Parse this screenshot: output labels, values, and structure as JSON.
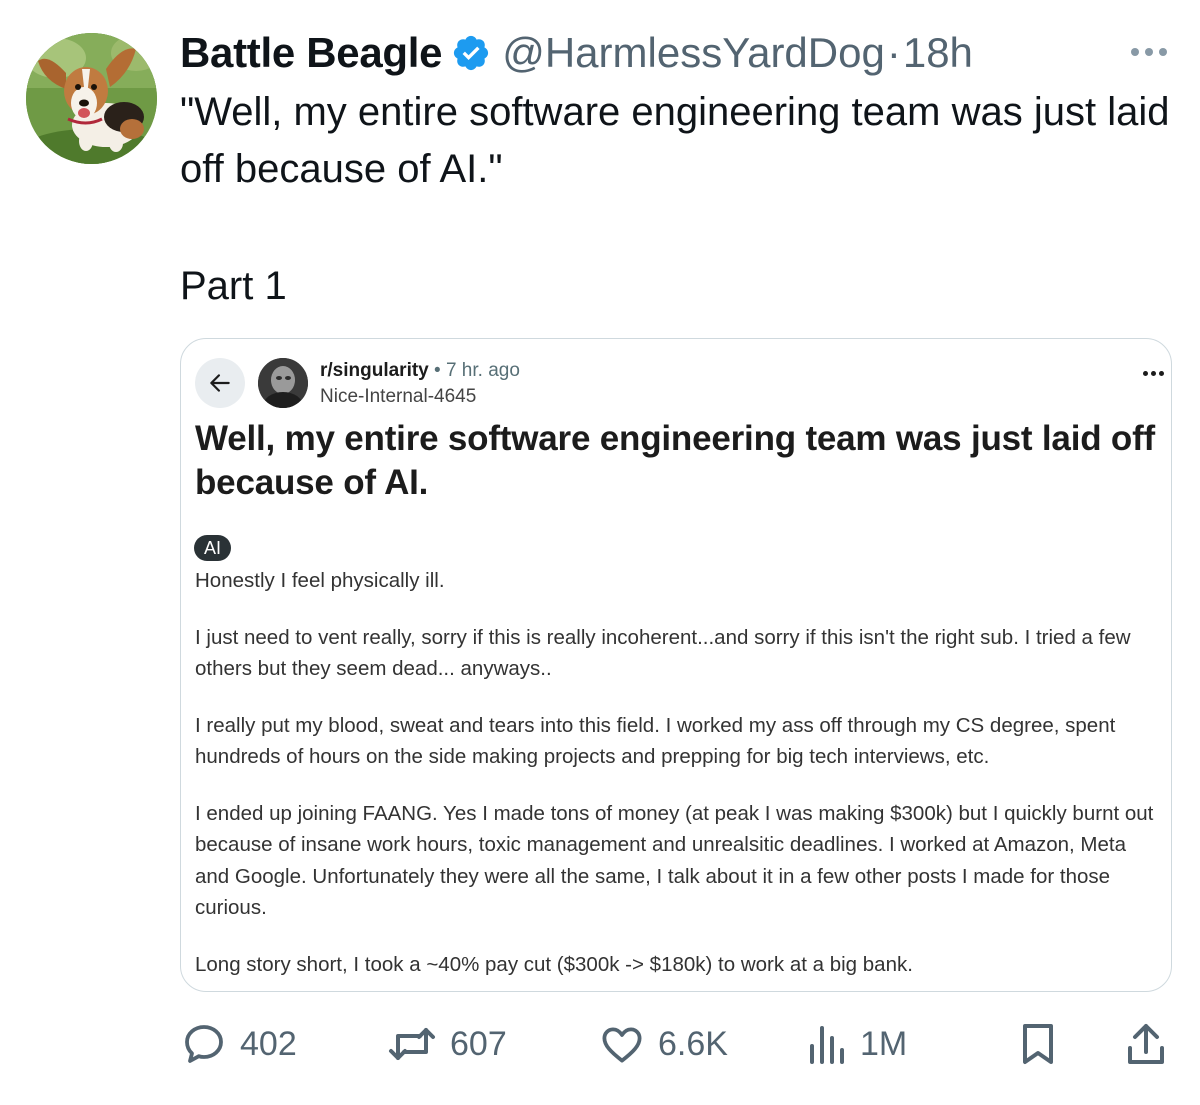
{
  "tweet": {
    "display_name": "Battle Beagle",
    "handle": "@HarmlessYardDog",
    "separator": "·",
    "time": "18h",
    "text": "\"Well, my entire software engineering team was just laid off because of AI.\"",
    "part_label": "Part 1",
    "verified_color": "#1d9bf0"
  },
  "embedded_post": {
    "subreddit": "r/singularity",
    "meta": "• 7 hr. ago",
    "author": "Nice-Internal-4645",
    "title": "Well, my entire software engineering team was just laid off because of AI.",
    "flair": "AI",
    "paragraphs": [
      "Honestly I feel physically ill.",
      "I just need to vent really, sorry if this is really incoherent...and sorry if this isn't the right sub. I tried a few others but they seem dead... anyways..",
      "I really put my blood, sweat and tears into this field. I worked my ass off through my CS degree, spent hundreds of hours on the side making projects and prepping for big tech interviews, etc.",
      "I ended up joining FAANG. Yes I made tons of money (at peak I was making $300k) but I quickly burnt out because of insane work hours, toxic management and unrealsitic deadlines. I worked at Amazon, Meta and Google. Unfortunately they were all the same, I talk about it in a few other posts I made for those curious.",
      "Long story short, I took a ~40% pay cut ($300k -> $180k) to work at a big bank."
    ]
  },
  "actions": {
    "replies": "402",
    "reposts": "607",
    "likes": "6.6K",
    "views": "1M"
  },
  "icons": {
    "verified": "verified-badge-icon",
    "more": "more-horizontal-icon",
    "back": "arrow-left-icon",
    "reply": "speech-bubble-icon",
    "repost": "repost-arrows-icon",
    "like": "heart-icon",
    "views": "bar-chart-icon",
    "bookmark": "bookmark-icon",
    "share": "share-upload-icon"
  }
}
